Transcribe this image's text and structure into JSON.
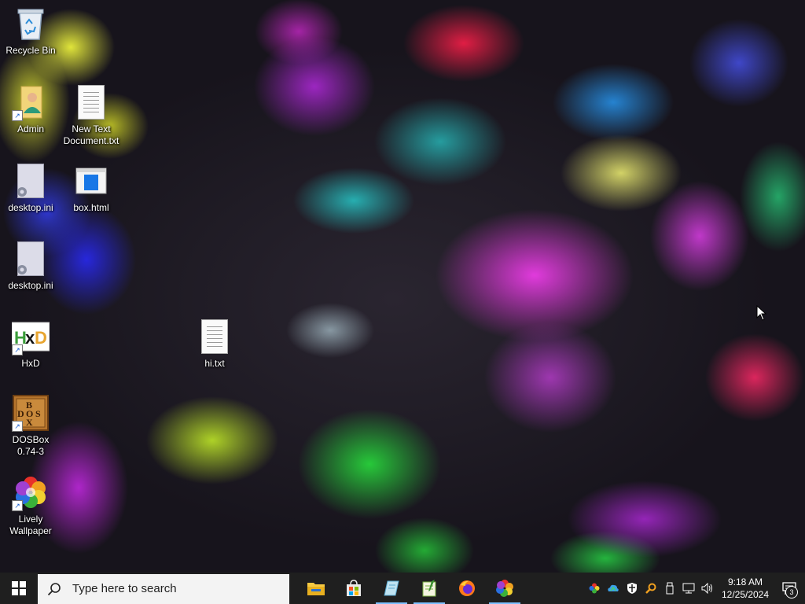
{
  "desktop": {
    "icons": [
      {
        "label": "Recycle Bin",
        "icon": "recycle-bin-icon"
      },
      {
        "label": "Admin",
        "icon": "user-folder-icon"
      },
      {
        "label": "New Text\nDocument.txt",
        "icon": "text-file-icon"
      },
      {
        "label": "desktop.ini",
        "icon": "settings-file-icon"
      },
      {
        "label": "box.html",
        "icon": "html-file-icon"
      },
      {
        "label": "desktop.ini",
        "icon": "settings-file-icon"
      },
      {
        "label": "HxD",
        "icon": "hxd-app-icon"
      },
      {
        "label": "hi.txt",
        "icon": "text-file-icon"
      },
      {
        "label": "DOSBox\n0.74-3",
        "icon": "dosbox-app-icon"
      },
      {
        "label": "Lively\nWallpaper",
        "icon": "lively-wallpaper-icon"
      }
    ]
  },
  "taskbar": {
    "start": {
      "icon": "windows-start-icon"
    },
    "search": {
      "placeholder": "Type here to search",
      "icon": "search-icon"
    },
    "apps": [
      {
        "name": "File Explorer",
        "icon": "file-explorer-icon",
        "active": false
      },
      {
        "name": "Microsoft Store",
        "icon": "store-icon",
        "active": false
      },
      {
        "name": "Notepad",
        "icon": "notepad-icon",
        "active": true
      },
      {
        "name": "Notepad++",
        "icon": "notepadpp-icon",
        "active": true
      },
      {
        "name": "Firefox",
        "icon": "firefox-icon",
        "active": false
      },
      {
        "name": "Lively Wallpaper",
        "icon": "lively-wallpaper-icon",
        "active": true
      }
    ],
    "tray": {
      "icons": [
        "lively-tray-icon",
        "cloud-sync-icon",
        "security-shield-icon",
        "search-tool-icon",
        "usb-device-icon",
        "network-icon",
        "volume-icon"
      ],
      "time": "9:18 AM",
      "date": "12/25/2024",
      "notification_count": "3"
    }
  },
  "colors": {
    "taskbar_bg": "#1f1f1f",
    "search_bg": "#f3f3f3",
    "accent": "#7cc0ff"
  }
}
